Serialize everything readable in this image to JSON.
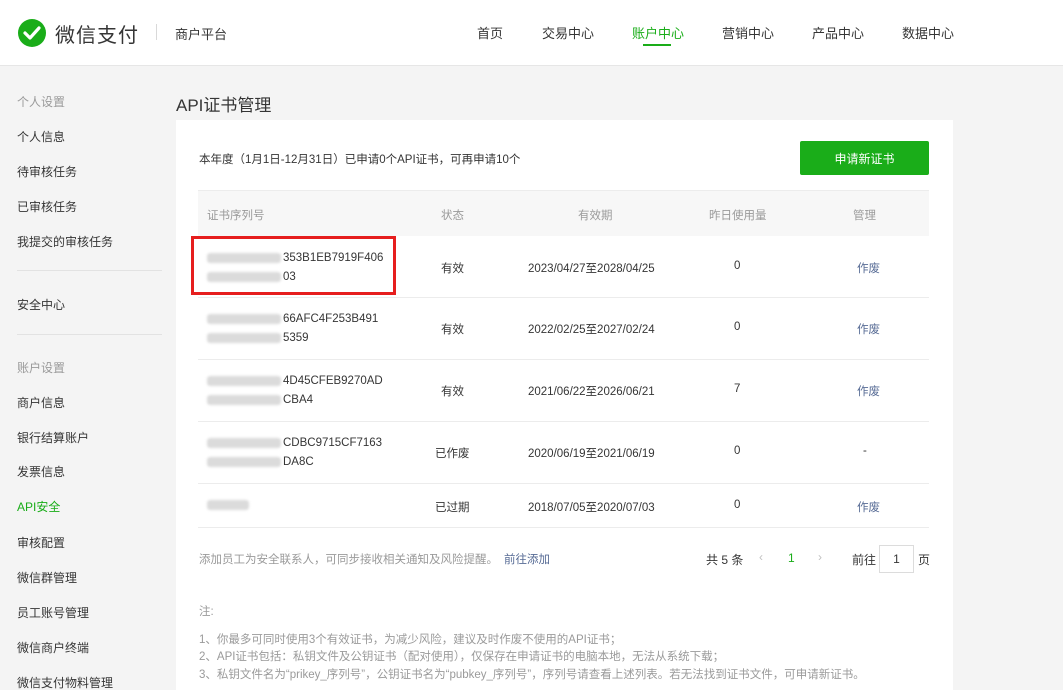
{
  "header": {
    "logo_text": "微信支付",
    "platform": "商户平台",
    "nav": [
      "首页",
      "交易中心",
      "账户中心",
      "营销中心",
      "产品中心",
      "数据中心"
    ],
    "active_nav": "账户中心"
  },
  "sidebar": {
    "group_personal": "个人设置",
    "personal_items": [
      "个人信息",
      "待审核任务",
      "已审核任务",
      "我提交的审核任务"
    ],
    "security": "安全中心",
    "group_account": "账户设置",
    "account_items": [
      "商户信息",
      "银行结算账户",
      "发票信息",
      "API安全",
      "审核配置",
      "微信群管理",
      "员工账号管理",
      "微信商户终端",
      "微信支付物料管理"
    ],
    "active_item": "API安全"
  },
  "main": {
    "title": "API证书管理",
    "quota_text": "本年度（1月1日-12月31日）已申请0个API证书，可再申请10个",
    "apply_button": "申请新证书",
    "columns": [
      "证书序列号",
      "状态",
      "有效期",
      "昨日使用量",
      "管理"
    ],
    "rows": [
      {
        "serial_line1": "353B1EB7919F406",
        "serial_line2": "03",
        "status": "有效",
        "validity": "2023/04/27至2028/04/25",
        "usage": "0",
        "action": "作废"
      },
      {
        "serial_line1": "66AFC4F253B491",
        "serial_line2": "5359",
        "status": "有效",
        "validity": "2022/02/25至2027/02/24",
        "usage": "0",
        "action": "作废"
      },
      {
        "serial_line1": "4D45CFEB9270AD",
        "serial_line2": "CBA4",
        "status": "有效",
        "validity": "2021/06/22至2026/06/21",
        "usage": "7",
        "action": "作废"
      },
      {
        "serial_line1": "CDBC9715CF7163",
        "serial_line2": "DA8C",
        "status": "已作废",
        "validity": "2020/06/19至2021/06/19",
        "usage": "0",
        "action": "-"
      },
      {
        "serial_line1": "",
        "serial_line2": "",
        "status": "已过期",
        "validity": "2018/07/05至2020/07/03",
        "usage": "0",
        "action": "作废"
      }
    ],
    "footer_tip": "添加员工为安全联系人，可同步接收相关通知及风险提醒。",
    "footer_link": "前往添加",
    "pager": {
      "total": "共 5 条",
      "prev": "‹",
      "current": "1",
      "next": "›",
      "goto": "前往",
      "page_value": "1",
      "page_unit": "页"
    },
    "notes_title": "注:",
    "notes": [
      "1、你最多可同时使用3个有效证书，为减少风险，建议及时作废不使用的API证书；",
      "2、API证书包括：私钥文件及公钥证书（配对使用），仅保存在申请证书的电脑本地，无法从系统下载；",
      "3、私钥文件名为“prikey_序列号”，公钥证书名为“pubkey_序列号”，序列号请查看上述列表。若无法找到证书文件，可申请新证书。"
    ]
  },
  "colors": {
    "accent": "#1aad19",
    "link": "#576b95",
    "highlight": "#e61e1e"
  }
}
